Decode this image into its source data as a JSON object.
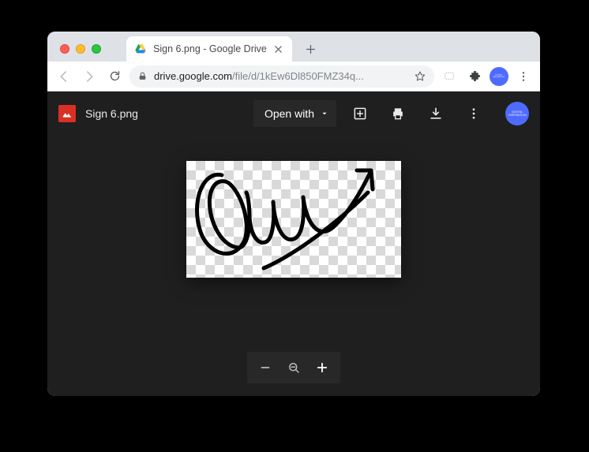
{
  "window": {
    "tab_title": "Sign 6.png - Google Drive",
    "url_host": "drive.google.com",
    "url_path": "/file/d/1kEw6Dl850FMZ34q...",
    "filename": "Sign 6.png",
    "open_with_label": "Open with",
    "profile_label": "DIGITAL INSPIRATION"
  },
  "icons": {
    "back": "back-icon",
    "forward": "forward-icon",
    "reload": "reload-icon",
    "lock": "lock-icon",
    "star": "star-icon",
    "cast": "cast-icon",
    "extension": "extension-icon",
    "menu": "menu-dots-icon",
    "tab_close": "close-icon",
    "new_tab": "plus-icon",
    "drive_favicon": "drive-favicon",
    "addperson": "add-person-icon",
    "print": "print-icon",
    "download": "download-icon",
    "more": "more-dots-icon",
    "zoom_out": "zoom-out-icon",
    "zoom_reset": "zoom-reset-icon",
    "zoom_in": "zoom-in-icon"
  }
}
